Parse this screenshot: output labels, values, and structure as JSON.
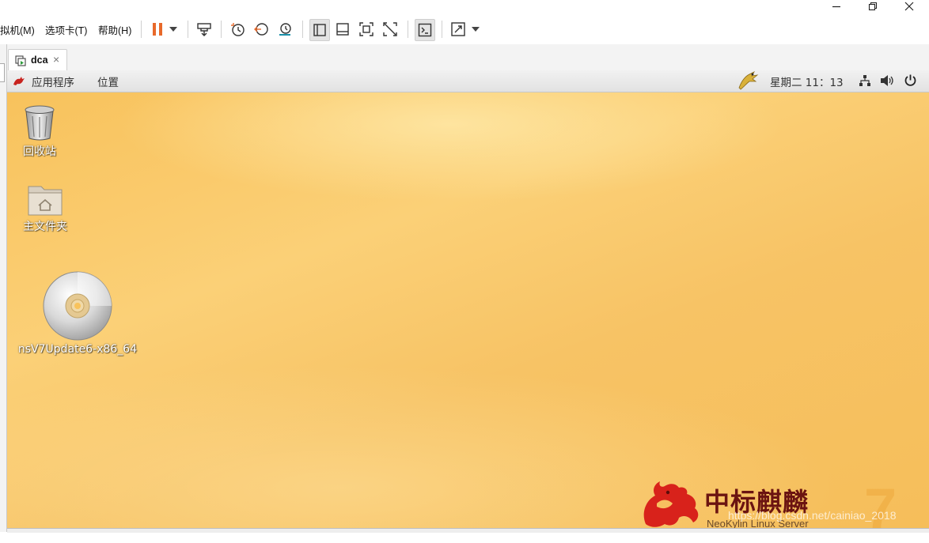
{
  "menu": {
    "vm": "拟机(M)",
    "tabs": "选项卡(T)",
    "help": "帮助(H)"
  },
  "vm_tab": {
    "title": "dca",
    "close": "×"
  },
  "panel": {
    "applications": "应用程序",
    "places": "位置",
    "clock": "星期二 11：13"
  },
  "desktop_icons": {
    "trash": "回收站",
    "home": "主文件夹",
    "disc": "nsV7Update6-x86_64"
  },
  "branding": {
    "name_cn": "中标麒麟",
    "name_en": "NeoKylin Linux Server",
    "version": "7"
  },
  "watermark": "https://blog.csdn.net/cainiao_2018",
  "colors": {
    "pause_accent": "#e8692a",
    "desktop_orange": "#f8c25c",
    "brand_red": "#6b1411"
  },
  "icons": {
    "toolbar": [
      "pause-icon",
      "send-ctrl-alt-del-icon",
      "snapshot-icon",
      "revert-snapshot-icon",
      "snapshot-manager-icon",
      "library-view-icon",
      "thumbnail-bar-icon",
      "full-screen-icon",
      "unity-icon",
      "console-view-icon",
      "stretch-icon"
    ],
    "panel": [
      "kylin-menu-icon",
      "weather-icon",
      "network-icon",
      "volume-icon",
      "power-icon"
    ]
  }
}
